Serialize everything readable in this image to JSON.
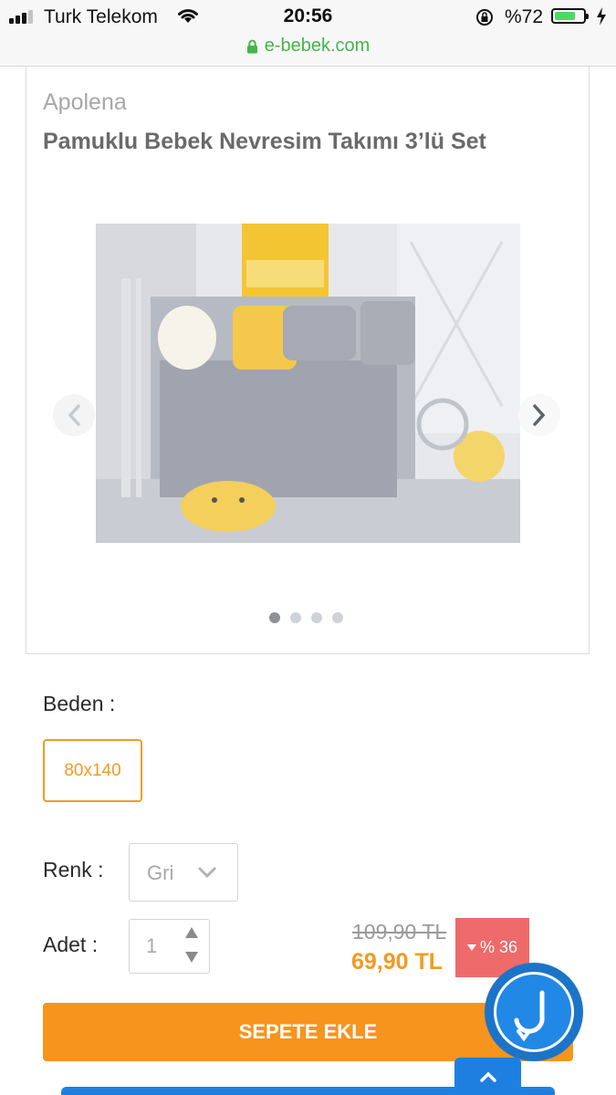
{
  "status_bar": {
    "carrier": "Turk Telekom",
    "time": "20:56",
    "battery_percent": "%72",
    "battery_level": 0.72,
    "icons": [
      "signal-icon",
      "wifi-icon",
      "rotation-lock-icon",
      "battery-icon",
      "charging-bolt-icon"
    ]
  },
  "browser": {
    "url": "e-bebek.com",
    "secure_icon": "lock-icon"
  },
  "product": {
    "brand": "Apolena",
    "title": "Pamuklu Bebek Nevresim Takımı 3’lü Set",
    "gallery": {
      "image_alt": "bedding-set-photo",
      "prev_icon": "chevron-left-icon",
      "next_icon": "chevron-right-icon",
      "slide_count": 4,
      "active_slide": 1
    }
  },
  "options": {
    "size_label": "Beden :",
    "size_value": "80x140",
    "color_label": "Renk :",
    "color_value": "Gri",
    "quantity_label": "Adet :",
    "quantity_value": "1"
  },
  "pricing": {
    "old_price": "109,90 TL",
    "new_price": "69,90 TL",
    "discount": "% 36"
  },
  "actions": {
    "add_to_cart": "SEPETE EKLE",
    "chat_icon": "chat-assistant-icon",
    "scroll_top_icon": "chevron-up-icon"
  },
  "colors": {
    "accent": "#f6941d",
    "discount_red": "#ef6a6a",
    "chat_blue": "#2288e6",
    "secure_green": "#46b449"
  }
}
